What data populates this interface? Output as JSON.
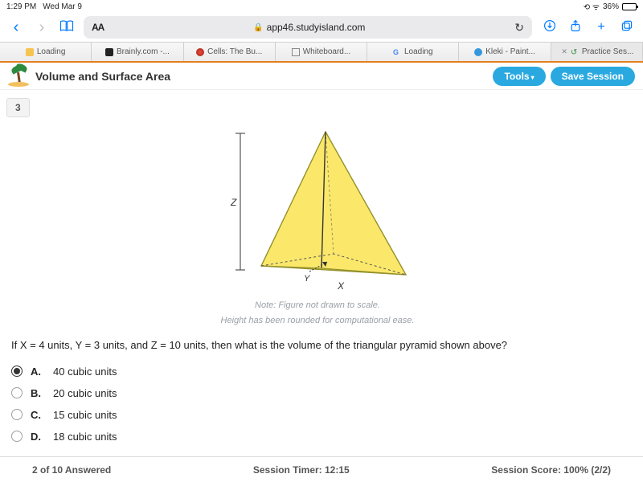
{
  "status": {
    "time": "1:29 PM",
    "date": "Wed Mar 9",
    "battery": "36%"
  },
  "browser": {
    "url_domain": "app46.studyisland.com",
    "aa_label": "AA",
    "tabs": [
      {
        "label": "Loading"
      },
      {
        "label": "Brainly.com -..."
      },
      {
        "label": "Cells: The Bu..."
      },
      {
        "label": "Whiteboard..."
      },
      {
        "label": "Loading"
      },
      {
        "label": "Kleki - Paint..."
      },
      {
        "label": "Practice Ses..."
      }
    ]
  },
  "header": {
    "title": "Volume and Surface Area",
    "tools_label": "Tools",
    "save_label": "Save Session"
  },
  "question": {
    "number": "3",
    "notes_line1": "Note: Figure not drawn to scale.",
    "notes_line2": "Height has been rounded for computational ease.",
    "prompt": "If X = 4 units, Y = 3 units, and Z = 10 units, then what is the volume of the triangular pyramid shown above?",
    "figure_labels": {
      "x": "X",
      "y": "Y",
      "z": "Z"
    },
    "options": [
      {
        "letter": "A.",
        "text": "40 cubic units",
        "selected": true
      },
      {
        "letter": "B.",
        "text": "20 cubic units",
        "selected": false
      },
      {
        "letter": "C.",
        "text": "15 cubic units",
        "selected": false
      },
      {
        "letter": "D.",
        "text": "18 cubic units",
        "selected": false
      }
    ]
  },
  "footer": {
    "answered": "2 of 10 Answered",
    "timer": "Session Timer: 12:15",
    "score": "Session Score: 100% (2/2)"
  }
}
